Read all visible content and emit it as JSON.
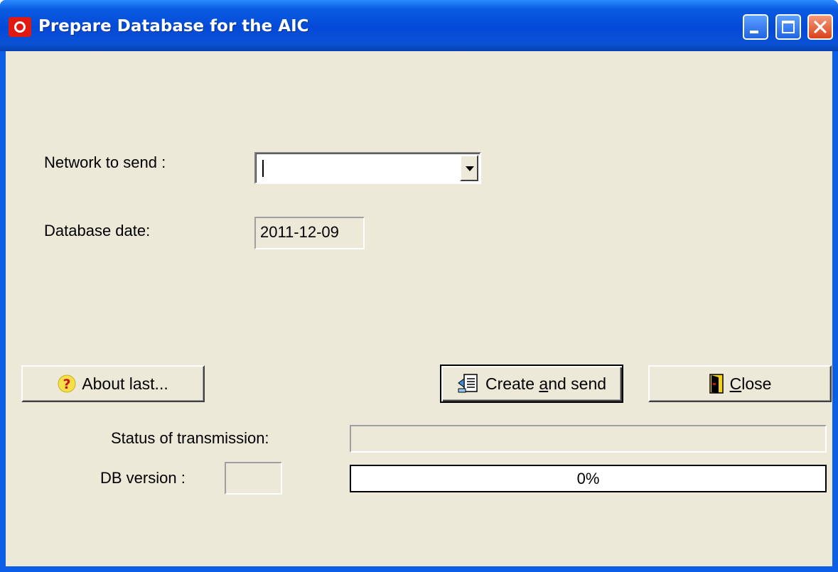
{
  "window": {
    "title": "Prepare Database for the AIC"
  },
  "form": {
    "network_label": "Network to send :",
    "network_value": "",
    "db_date_label": "Database date:",
    "db_date_value": "2011-12-09",
    "status_label": "Status of transmission:",
    "status_value": "",
    "db_version_label": "DB version :",
    "db_version_value": ""
  },
  "buttons": {
    "about_label": "About last...",
    "create_send_pre": "Create ",
    "create_send_mnemonic": "a",
    "create_send_post": "nd send",
    "close_mnemonic": "C",
    "close_post": "lose"
  },
  "progress": {
    "value": 0,
    "label": "0%"
  },
  "icons": {
    "app": "app-logo-icon",
    "about": "question-icon",
    "create_send": "document-send-icon",
    "close": "exit-door-icon"
  },
  "colors": {
    "titlebar": "#0449d8",
    "client_bg": "#ece9d8",
    "close_button": "#d9421b"
  }
}
